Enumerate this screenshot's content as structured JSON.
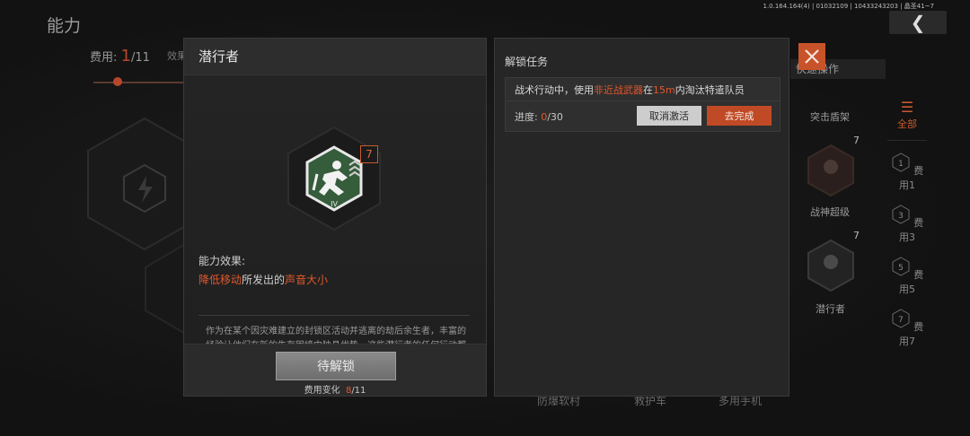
{
  "background": {
    "page_title": "能力",
    "version": "1.0.164.164(4) | 01032109 | 10433243203 | 晶圣41~7",
    "back_icon": "chevron-left-icon",
    "cost_label": "费用:",
    "cost_current": "1",
    "cost_total": "/11",
    "effect_tab": "效果",
    "quick_ops": "快速操作",
    "card_labels": [
      "突击盾架",
      "战神超级",
      "潜行者"
    ],
    "card_level": "7",
    "bottom_items": [
      "防爆软村",
      "救护车",
      "多用手机"
    ],
    "filters": [
      {
        "label": "全部",
        "badge": ""
      },
      {
        "label": "费用1",
        "badge": "1"
      },
      {
        "label": "费用3",
        "badge": "3"
      },
      {
        "label": "费用5",
        "badge": "5"
      },
      {
        "label": "费用7",
        "badge": "7"
      }
    ]
  },
  "ability": {
    "name": "潜行者",
    "level": "7",
    "tier": "IV",
    "icon": "sneaking-runner-icon",
    "effect_label": "能力效果:",
    "effect_part1": "降低移动",
    "effect_part2": "所发出的",
    "effect_part3": "声音大小",
    "description": "作为在某个因灾难建立的封锁区活动并逃离的劫后余生者，丰富的经验让他们在新的生存困境中独具优势，这些潜行者的任何行动都更难被耳朵觉察。",
    "unlock_button": "待解锁",
    "cost_change_label": "费用变化",
    "cost_change_current": "8",
    "cost_change_total": "/11"
  },
  "unlock_task": {
    "title": "解锁任务",
    "text_part1": "战术行动中，使用",
    "text_part2": "非近战武器",
    "text_part3": "在",
    "text_part4": "15m",
    "text_part5": "内淘汰特遣队员",
    "progress_label": "进度:",
    "progress_current": "0",
    "progress_total": "/30",
    "progress_fraction": 0.0,
    "cancel_button": "取消激活",
    "complete_button": "去完成"
  },
  "colors": {
    "accent": "#e2572c",
    "button_orange": "#c04a26",
    "panel": "#262626",
    "icon_green": "#3f6b44"
  }
}
